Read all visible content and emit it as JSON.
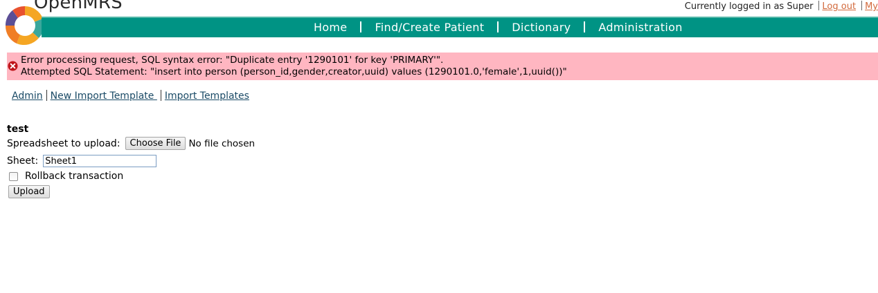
{
  "app": {
    "brand": "OpenMRS",
    "logo_icon": "openmrs-logo-icon",
    "colors": {
      "navbar": "#009384",
      "error_bg": "#ffb6c1",
      "logout_link": "#d2693b"
    }
  },
  "userbar": {
    "logged_in_text": "Currently logged in as Super",
    "logout": "Log out",
    "my_profile": "My"
  },
  "nav": {
    "items": [
      "Home",
      "Find/Create Patient",
      "Dictionary",
      "Administration"
    ]
  },
  "error": {
    "icon": "error-x-icon",
    "line1": "Error processing request, SQL syntax error: \"Duplicate entry '1290101' for key 'PRIMARY'\".",
    "line2": "Attempted SQL Statement: \"insert into person (person_id,gender,creator,uuid) values (1290101.0,'female',1,uuid())\""
  },
  "links": {
    "admin": "Admin",
    "new_import_template": "New Import Template ",
    "import_templates": "Import Templates"
  },
  "form": {
    "title": "test",
    "spreadsheet_label": "Spreadsheet to upload:",
    "choose_file_label": "Choose File",
    "no_file_text": "No file chosen",
    "sheet_label": "Sheet:",
    "sheet_value": "Sheet1",
    "rollback_label": "Rollback transaction",
    "rollback_checked": false,
    "upload_label": "Upload"
  }
}
